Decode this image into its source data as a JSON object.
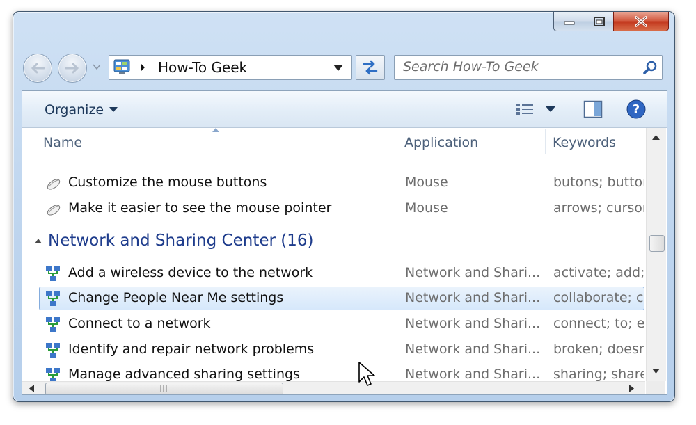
{
  "window": {
    "caption_buttons": [
      "minimize",
      "maximize",
      "close"
    ]
  },
  "navigation": {
    "back_icon": "back-arrow",
    "forward_icon": "forward-arrow"
  },
  "address": {
    "location": "How-To Geek",
    "icon": "control-panel-icon"
  },
  "search": {
    "placeholder": "Search How-To Geek"
  },
  "toolbar": {
    "organize_label": "Organize"
  },
  "columns": [
    "Name",
    "Application",
    "Keywords"
  ],
  "rows_top": [
    {
      "name": "Customize the mouse buttons",
      "app": "Mouse",
      "keywords": "butons; buttons"
    },
    {
      "name": "Make it easier to see the mouse pointer",
      "app": "Mouse",
      "keywords": "arrows; cursor"
    }
  ],
  "group": {
    "title": "Network and Sharing Center (16)"
  },
  "rows_network": [
    {
      "name": "Add a wireless device to the network",
      "app": "Network and Shari...",
      "keywords": "activate; add; b"
    },
    {
      "name": "Change People Near Me settings",
      "app": "Network and Shari...",
      "keywords": "collaborate; co"
    },
    {
      "name": "Connect to a network",
      "app": "Network and Shari...",
      "keywords": "connect; to; en"
    },
    {
      "name": "Identify and repair network problems",
      "app": "Network and Shari...",
      "keywords": "broken; doesn"
    },
    {
      "name": "Manage advanced sharing settings",
      "app": "Network and Shari...",
      "keywords": "sharing; shared"
    }
  ],
  "colors": {
    "selection_border": "#84acdd",
    "group_title": "#1e3c8c",
    "close_red": "#c2361c"
  }
}
